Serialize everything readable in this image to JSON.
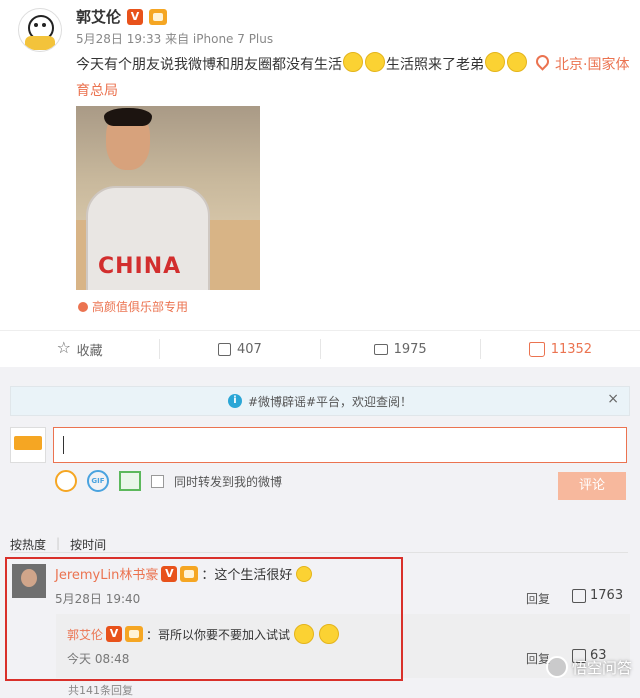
{
  "post": {
    "author": "郭艾伦",
    "v_badge": "V",
    "meta": "5月28日 19:33 来自 iPhone 7 Plus",
    "text_part1": "今天有个朋友说我微博和朋友圈都没有生活",
    "text_part2": "生活照来了老弟",
    "location": "北京·国家体育总局",
    "photo_text": "CHINA",
    "source": "高颜值俱乐部专用"
  },
  "actions": {
    "favorite": "收藏",
    "repost": "407",
    "comment": "1975",
    "like": "11352"
  },
  "notice": {
    "text": "#微博辟谣#平台，欢迎查阅！",
    "close": "×"
  },
  "composer": {
    "repost_label": "同时转发到我的微博",
    "submit": "评论"
  },
  "sort": {
    "hot": "按热度",
    "time": "按时间"
  },
  "comments": [
    {
      "name": "JeremyLin林书豪",
      "text": "：这个生活很好",
      "time": "5月28日 19:40",
      "reply": "回复",
      "likes": "1763"
    }
  ],
  "sub_reply": {
    "name": "郭艾伦",
    "text": "：哥所以你要不要加入试试",
    "time": "今天 08:48",
    "reply": "回复",
    "likes": "63"
  },
  "more": "共141条回复",
  "watermark": "悟空问答",
  "colors": {
    "accent": "#eb7350",
    "highlight": "#d9302a"
  }
}
